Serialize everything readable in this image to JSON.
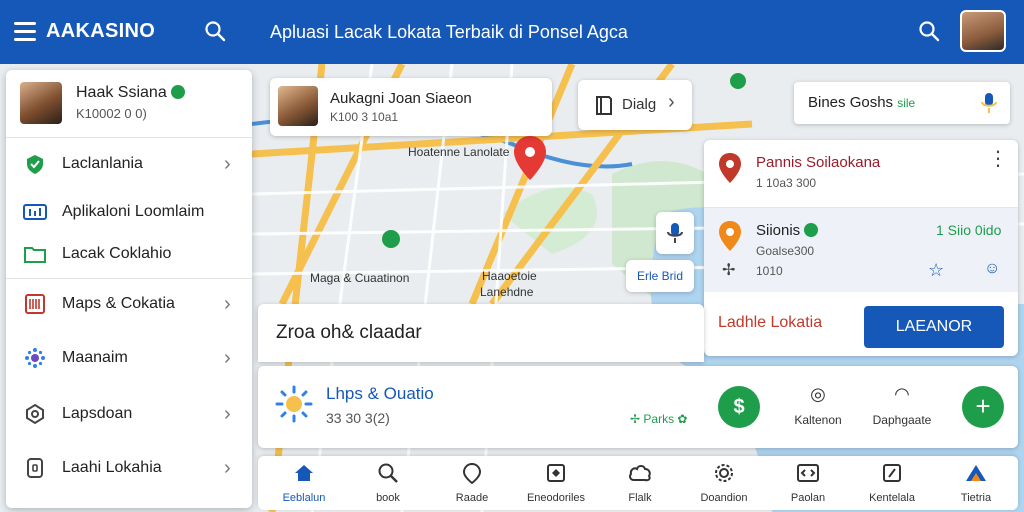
{
  "colors": {
    "primary": "#1658b8",
    "accent_green": "#1e9e4a",
    "danger_red": "#c0392b",
    "map_bg": "#e8ecef"
  },
  "appbar": {
    "brand": "AAKASINO",
    "title": "Apluasi Lacak Lokata Terbaik di Ponsel Agca",
    "icons": [
      "menu-icon",
      "search-icon",
      "search-icon",
      "avatar"
    ]
  },
  "drawer": {
    "user_name": "Haak Ssiana",
    "user_sub": "K10002 0 0)",
    "items": [
      {
        "label": "Laclanlania",
        "icon": "shield-icon",
        "chevron": true
      },
      {
        "label": "Aplikaloni Loomlaim",
        "icon": "chart-icon",
        "chevron": false
      },
      {
        "label": "Lacak Coklahio",
        "icon": "folder-icon",
        "chevron": false
      },
      {
        "label": "Maps & Cokatia",
        "icon": "barcode-icon",
        "chevron": true
      },
      {
        "label": "Maanaim",
        "icon": "flower-icon",
        "chevron": true
      },
      {
        "label": "Lapsdoan",
        "icon": "location-icon",
        "chevron": true
      },
      {
        "label": "Laahi Lokahia",
        "icon": "phone-icon",
        "chevron": true
      }
    ]
  },
  "map": {
    "labels": [
      "Maga & Cuaatinon",
      "Hoatenne Lanolate",
      "Haaoetoie",
      "Lanehdne"
    ]
  },
  "location_card": {
    "name": "Aukagni Joan Siaeon",
    "sub": "K100 3 10a1"
  },
  "dialog_card": {
    "label": "Dialg"
  },
  "search_pill": {
    "label": "Bines Goshs",
    "tag": "sile"
  },
  "edit_button": {
    "label": "Erle Brid"
  },
  "right_panel": {
    "row1": {
      "title": "Pannis Soilaokana",
      "sub": "1 10a3 300"
    },
    "row2": {
      "title": "Siionis",
      "sub": "Goalse300",
      "sub2": "1010",
      "value": "1 Siio 0ido"
    },
    "row3": {
      "label": "Ladhle Lokatia",
      "button": "LAEANOR"
    }
  },
  "zoom_card": {
    "label": "Zroa oh& claadar"
  },
  "app_card": {
    "title": "Lhps & Ouatio",
    "sub": "33 30 3(2)",
    "parks": "Parks",
    "dollar": "$",
    "actions": [
      {
        "label": "Kaltenon",
        "icon": "clock-icon"
      },
      {
        "label": "Daphgaate",
        "icon": "gauge-icon"
      }
    ]
  },
  "bottom_nav": [
    {
      "label": "Eeblalun",
      "icon": "home-icon",
      "active": true
    },
    {
      "label": "book",
      "icon": "search-icon",
      "active": false
    },
    {
      "label": "Raade",
      "icon": "pin-icon",
      "active": false
    },
    {
      "label": "Eneodoriles",
      "icon": "grid-icon",
      "active": false
    },
    {
      "label": "Flalk",
      "icon": "cloud-icon",
      "active": false
    },
    {
      "label": "Doandion",
      "icon": "gear-icon",
      "active": false
    },
    {
      "label": "Paolan",
      "icon": "code-icon",
      "active": false
    },
    {
      "label": "Kentelala",
      "icon": "edit-icon",
      "active": false
    },
    {
      "label": "Tietria",
      "icon": "mountain-icon",
      "active": false
    }
  ]
}
